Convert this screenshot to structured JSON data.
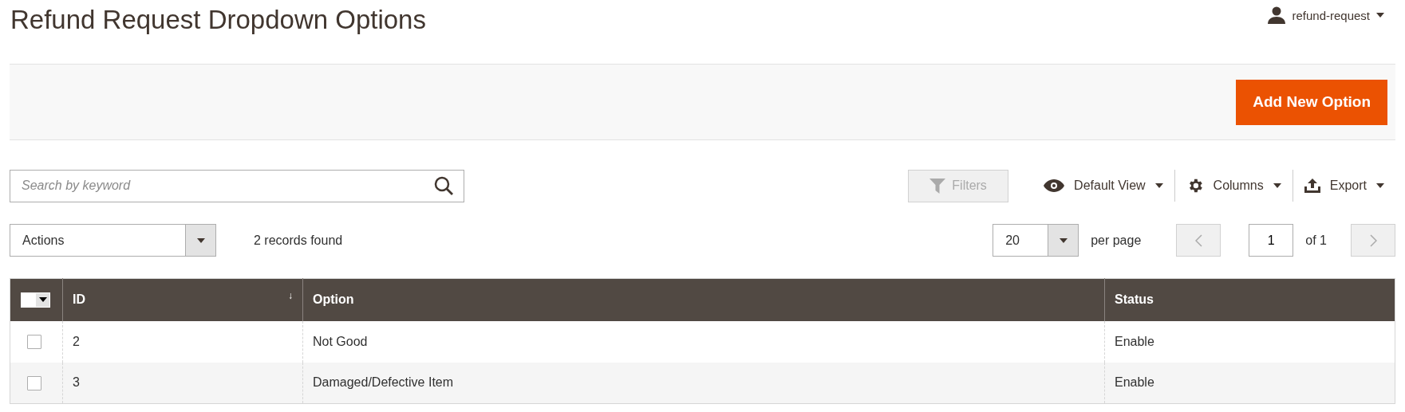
{
  "page_title": "Refund Request Dropdown Options",
  "user": {
    "name": "refund-request"
  },
  "add_button": "Add New Option",
  "search": {
    "placeholder": "Search by keyword"
  },
  "toolbar": {
    "filters": {
      "label": "Filters",
      "disabled": true
    },
    "controls": [
      {
        "kind": "view",
        "label": "Default View"
      },
      {
        "kind": "columns",
        "label": "Columns"
      },
      {
        "kind": "export",
        "label": "Export"
      }
    ]
  },
  "actions": {
    "label": "Actions"
  },
  "records": "2 records found",
  "pagination": {
    "per_page": "20",
    "per_page_label": "per page",
    "page": "1",
    "of": "of 1"
  },
  "table": {
    "columns": [
      {
        "label": "ID",
        "sorted": true
      },
      {
        "label": "Option",
        "sorted": false
      },
      {
        "label": "Status",
        "sorted": false
      }
    ],
    "sort_mark": "↓",
    "rows": [
      {
        "checked": false,
        "cells": [
          "2",
          "Not Good",
          "Enable"
        ]
      },
      {
        "checked": false,
        "cells": [
          "3",
          "Damaged/Defective Item",
          "Enable"
        ]
      }
    ]
  }
}
